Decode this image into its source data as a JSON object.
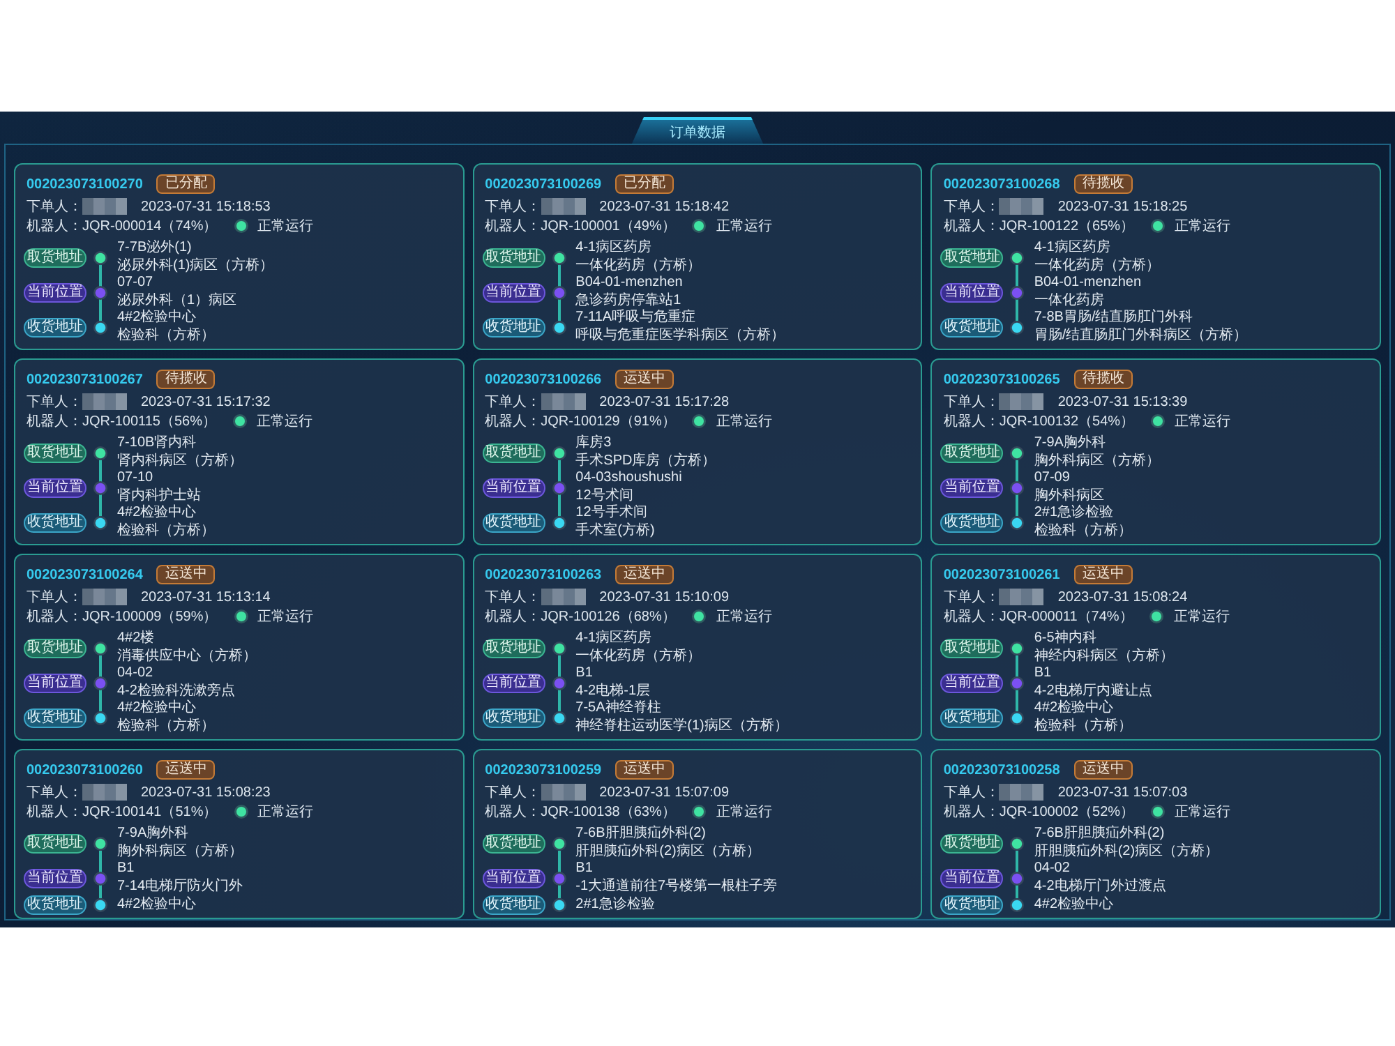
{
  "panel": {
    "title": "订单数据"
  },
  "orders": [
    {
      "order_no": "002023073100270",
      "status": "已分配",
      "orderer_label": "下单人：",
      "time": "2023-07-31 15:18:53",
      "robot": "机器人：JQR-000014（74%）",
      "robot_status": "正常运行",
      "stops": [
        {
          "kind": "pickup",
          "label": "取货地址",
          "lines": [
            "7-7B泌外(1)",
            "泌尿外科(1)病区（方桥）"
          ]
        },
        {
          "kind": "current",
          "label": "当前位置",
          "lines": [
            "07-07",
            "泌尿外科（1）病区"
          ]
        },
        {
          "kind": "delivery",
          "label": "收货地址",
          "lines": [
            "4#2检验中心",
            "检验科（方桥）"
          ]
        }
      ]
    },
    {
      "order_no": "002023073100269",
      "status": "已分配",
      "orderer_label": "下单人：",
      "time": "2023-07-31 15:18:42",
      "robot": "机器人：JQR-100001（49%）",
      "robot_status": "正常运行",
      "stops": [
        {
          "kind": "pickup",
          "label": "取货地址",
          "lines": [
            "4-1病区药房",
            "一体化药房（方桥）"
          ]
        },
        {
          "kind": "current",
          "label": "当前位置",
          "lines": [
            "B04-01-menzhen",
            "急诊药房停靠站1"
          ]
        },
        {
          "kind": "delivery",
          "label": "收货地址",
          "lines": [
            "7-11A呼吸与危重症",
            "呼吸与危重症医学科病区（方桥）"
          ]
        }
      ]
    },
    {
      "order_no": "002023073100268",
      "status": "待揽收",
      "orderer_label": "下单人：",
      "time": "2023-07-31 15:18:25",
      "robot": "机器人：JQR-100122（65%）",
      "robot_status": "正常运行",
      "stops": [
        {
          "kind": "pickup",
          "label": "取货地址",
          "lines": [
            "4-1病区药房",
            "一体化药房（方桥）"
          ]
        },
        {
          "kind": "current",
          "label": "当前位置",
          "lines": [
            "B04-01-menzhen",
            "一体化药房"
          ]
        },
        {
          "kind": "delivery",
          "label": "收货地址",
          "lines": [
            "7-8B胃肠/结直肠肛门外科",
            "胃肠/结直肠肛门外科病区（方桥）"
          ]
        }
      ]
    },
    {
      "order_no": "002023073100267",
      "status": "待揽收",
      "orderer_label": "下单人：",
      "time": "2023-07-31 15:17:32",
      "robot": "机器人：JQR-100115（56%）",
      "robot_status": "正常运行",
      "stops": [
        {
          "kind": "pickup",
          "label": "取货地址",
          "lines": [
            "7-10B肾内科",
            "肾内科病区（方桥）"
          ]
        },
        {
          "kind": "current",
          "label": "当前位置",
          "lines": [
            "07-10",
            "肾内科护士站"
          ]
        },
        {
          "kind": "delivery",
          "label": "收货地址",
          "lines": [
            "4#2检验中心",
            "检验科（方桥）"
          ]
        }
      ]
    },
    {
      "order_no": "002023073100266",
      "status": "运送中",
      "orderer_label": "下单人：",
      "time": "2023-07-31 15:17:28",
      "robot": "机器人：JQR-100129（91%）",
      "robot_status": "正常运行",
      "stops": [
        {
          "kind": "pickup",
          "label": "取货地址",
          "lines": [
            "库房3",
            "手术SPD库房（方桥）"
          ]
        },
        {
          "kind": "current",
          "label": "当前位置",
          "lines": [
            "04-03shoushushi",
            "12号术间"
          ]
        },
        {
          "kind": "delivery",
          "label": "收货地址",
          "lines": [
            "12号手术间",
            "手术室(方桥)"
          ]
        }
      ]
    },
    {
      "order_no": "002023073100265",
      "status": "待揽收",
      "orderer_label": "下单人：",
      "time": "2023-07-31 15:13:39",
      "robot": "机器人：JQR-100132（54%）",
      "robot_status": "正常运行",
      "stops": [
        {
          "kind": "pickup",
          "label": "取货地址",
          "lines": [
            "7-9A胸外科",
            "胸外科病区（方桥）"
          ]
        },
        {
          "kind": "current",
          "label": "当前位置",
          "lines": [
            "07-09",
            "胸外科病区"
          ]
        },
        {
          "kind": "delivery",
          "label": "收货地址",
          "lines": [
            "2#1急诊检验",
            "检验科（方桥）"
          ]
        }
      ]
    },
    {
      "order_no": "002023073100264",
      "status": "运送中",
      "orderer_label": "下单人：",
      "time": "2023-07-31 15:13:14",
      "robot": "机器人：JQR-100009（59%）",
      "robot_status": "正常运行",
      "stops": [
        {
          "kind": "pickup",
          "label": "取货地址",
          "lines": [
            "4#2楼",
            "消毒供应中心（方桥）"
          ]
        },
        {
          "kind": "current",
          "label": "当前位置",
          "lines": [
            "04-02",
            "4-2检验科洗漱旁点"
          ]
        },
        {
          "kind": "delivery",
          "label": "收货地址",
          "lines": [
            "4#2检验中心",
            "检验科（方桥）"
          ]
        }
      ]
    },
    {
      "order_no": "002023073100263",
      "status": "运送中",
      "orderer_label": "下单人：",
      "time": "2023-07-31 15:10:09",
      "robot": "机器人：JQR-100126（68%）",
      "robot_status": "正常运行",
      "stops": [
        {
          "kind": "pickup",
          "label": "取货地址",
          "lines": [
            "4-1病区药房",
            "一体化药房（方桥）"
          ]
        },
        {
          "kind": "current",
          "label": "当前位置",
          "lines": [
            "B1",
            "4-2电梯-1层"
          ]
        },
        {
          "kind": "delivery",
          "label": "收货地址",
          "lines": [
            "7-5A神经脊柱",
            "神经脊柱运动医学(1)病区（方桥）"
          ]
        }
      ]
    },
    {
      "order_no": "002023073100261",
      "status": "运送中",
      "orderer_label": "下单人：",
      "time": "2023-07-31 15:08:24",
      "robot": "机器人：JQR-000011（74%）",
      "robot_status": "正常运行",
      "stops": [
        {
          "kind": "pickup",
          "label": "取货地址",
          "lines": [
            "6-5神内科",
            "神经内科病区（方桥）"
          ]
        },
        {
          "kind": "current",
          "label": "当前位置",
          "lines": [
            "B1",
            "4-2电梯厅内避让点"
          ]
        },
        {
          "kind": "delivery",
          "label": "收货地址",
          "lines": [
            "4#2检验中心",
            "检验科（方桥）"
          ]
        }
      ]
    },
    {
      "order_no": "002023073100260",
      "status": "运送中",
      "orderer_label": "下单人：",
      "time": "2023-07-31 15:08:23",
      "robot": "机器人：JQR-100141（51%）",
      "robot_status": "正常运行",
      "stops": [
        {
          "kind": "pickup",
          "label": "取货地址",
          "lines": [
            "7-9A胸外科",
            "胸外科病区（方桥）"
          ]
        },
        {
          "kind": "current",
          "label": "当前位置",
          "lines": [
            "B1",
            "7-14电梯厅防火门外"
          ]
        },
        {
          "kind": "delivery",
          "label": "收货地址",
          "lines": [
            "4#2检验中心"
          ]
        }
      ]
    },
    {
      "order_no": "002023073100259",
      "status": "运送中",
      "orderer_label": "下单人：",
      "time": "2023-07-31 15:07:09",
      "robot": "机器人：JQR-100138（63%）",
      "robot_status": "正常运行",
      "stops": [
        {
          "kind": "pickup",
          "label": "取货地址",
          "lines": [
            "7-6B肝胆胰疝外科(2)",
            "肝胆胰疝外科(2)病区（方桥）"
          ]
        },
        {
          "kind": "current",
          "label": "当前位置",
          "lines": [
            "B1",
            "-1大通道前往7号楼第一根柱子旁"
          ]
        },
        {
          "kind": "delivery",
          "label": "收货地址",
          "lines": [
            "2#1急诊检验"
          ]
        }
      ]
    },
    {
      "order_no": "002023073100258",
      "status": "运送中",
      "orderer_label": "下单人：",
      "time": "2023-07-31 15:07:03",
      "robot": "机器人：JQR-100002（52%）",
      "robot_status": "正常运行",
      "stops": [
        {
          "kind": "pickup",
          "label": "取货地址",
          "lines": [
            "7-6B肝胆胰疝外科(2)",
            "肝胆胰疝外科(2)病区（方桥）"
          ]
        },
        {
          "kind": "current",
          "label": "当前位置",
          "lines": [
            "04-02",
            "4-2电梯厅门外过渡点"
          ]
        },
        {
          "kind": "delivery",
          "label": "收货地址",
          "lines": [
            "4#2检验中心"
          ]
        }
      ]
    }
  ]
}
